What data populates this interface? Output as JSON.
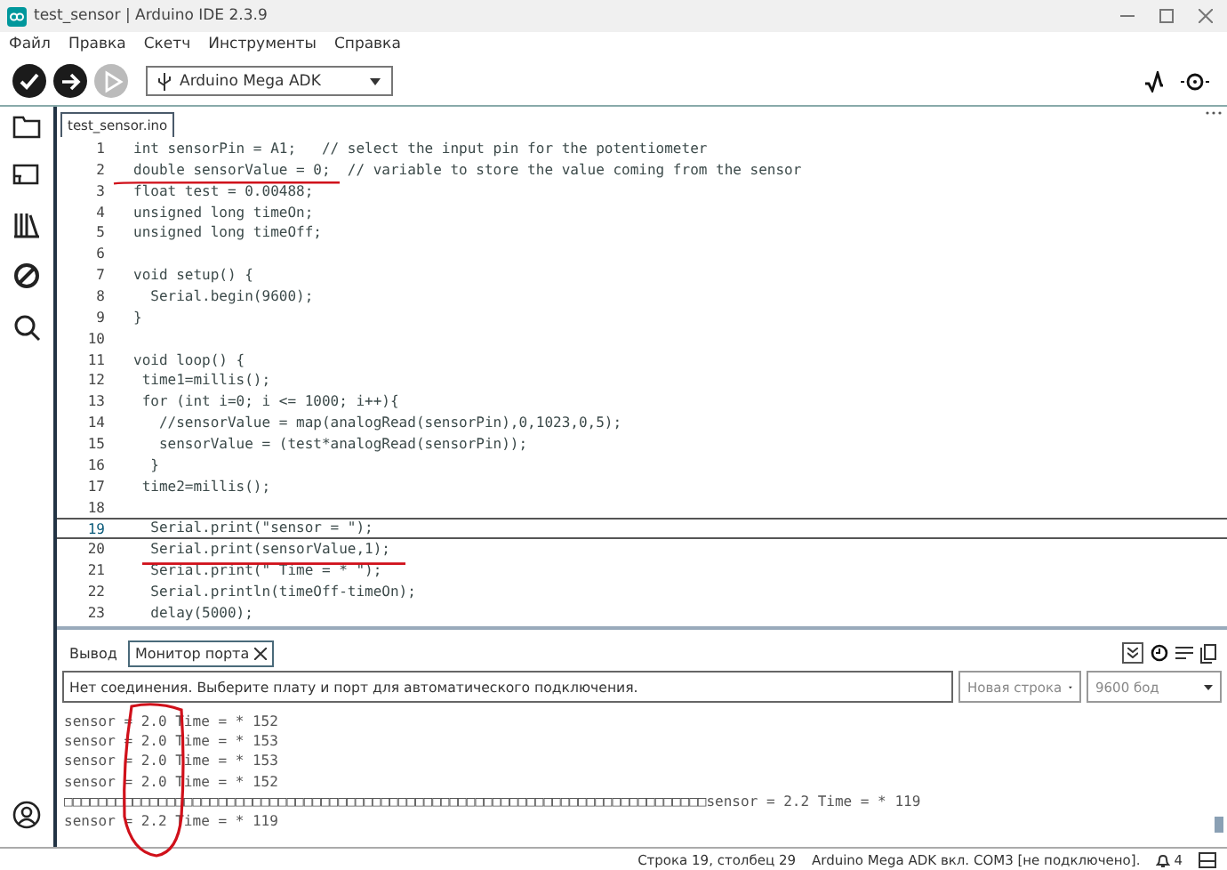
{
  "window": {
    "title": "test_sensor | Arduino IDE 2.3.9"
  },
  "menu": [
    "Файл",
    "Правка",
    "Скетч",
    "Инструменты",
    "Справка"
  ],
  "toolbar": {
    "buttons": [
      {
        "kind": "verify",
        "disabled": false
      },
      {
        "kind": "upload",
        "disabled": false
      },
      {
        "kind": "debug",
        "disabled": true
      }
    ],
    "board": "Arduino Mega ADK"
  },
  "editor": {
    "tabs": [
      {
        "label": "test_sensor.ino",
        "selected": true
      }
    ],
    "lines": [
      {
        "number": "1",
        "code": "int sensorPin = A1;   // select the input pin for the potentiometer",
        "selected": false
      },
      {
        "number": "2",
        "code": "double sensorValue = 0;  // variable to store the value coming from the sensor",
        "selected": false
      },
      {
        "number": "3",
        "code": "float test = 0.00488;",
        "selected": false
      },
      {
        "number": "4",
        "code": "unsigned long timeOn;",
        "selected": false
      },
      {
        "number": "5",
        "code": "unsigned long timeOff;",
        "selected": false
      },
      {
        "number": "6",
        "selected": false
      },
      {
        "number": "7",
        "code": "void setup() {",
        "selected": false
      },
      {
        "number": "8",
        "code": "  Serial.begin(9600);",
        "selected": false
      },
      {
        "number": "9",
        "code": "}",
        "selected": false
      },
      {
        "number": "10",
        "selected": false
      },
      {
        "number": "11",
        "code": "void loop() {",
        "selected": false
      },
      {
        "number": "12",
        "code": " time1=millis();",
        "selected": false
      },
      {
        "number": "13",
        "code": " for (int i=0; i <= 1000; i++){",
        "selected": false
      },
      {
        "number": "14",
        "code": "   //sensorValue = map(analogRead(sensorPin),0,1023,0,5);",
        "selected": false
      },
      {
        "number": "15",
        "code": "   sensorValue = (test*analogRead(sensorPin));",
        "selected": false
      },
      {
        "number": "16",
        "code": "  }",
        "selected": false
      },
      {
        "number": "17",
        "code": " time2=millis();",
        "selected": false
      },
      {
        "number": "18",
        "selected": false
      },
      {
        "number": "19",
        "code": "  Serial.print(\"sensor = \");",
        "selected": true
      },
      {
        "number": "20",
        "code": "  Serial.print(sensorValue,1);",
        "selected": false
      },
      {
        "number": "21",
        "code": "  Serial.print(\" Time = * \");",
        "selected": false
      },
      {
        "number": "22",
        "code": "  Serial.println(timeOff-timeOn);",
        "selected": false
      },
      {
        "number": "23",
        "code": "  delay(5000);",
        "selected": false
      }
    ]
  },
  "panel": {
    "tabs": [
      {
        "label": "Вывод",
        "selected": false,
        "closable": false
      },
      {
        "label": "Монитор порта",
        "selected": true,
        "closable": true
      }
    ],
    "message_field": {
      "placeholder": "Нет соединения. Выберите плату и порт для автоматического подключения."
    },
    "line_ending": "Новая строка",
    "baud": "9600 бод",
    "output": [
      "sensor = 2.0 Time = * 152",
      "sensor = 2.0 Time = * 153",
      "sensor = 2.0 Time = * 153",
      "sensor = 2.0 Time = * 152",
      "□□□□□□□□□□□□□□□□□□□□□□□□□□□□□□□□□□□□□□□□□□□□□□□□□□□□□□□□□□□□□□□□□□□□□□□□□□□sensor = 2.2 Time = * 119",
      "sensor = 2.2 Time = * 119"
    ]
  },
  "status_bar": {
    "position": "Строка 19, столбец 29",
    "board": "Arduino Mega ADK вкл. COM3 [не подключено].",
    "notifications": "4"
  }
}
